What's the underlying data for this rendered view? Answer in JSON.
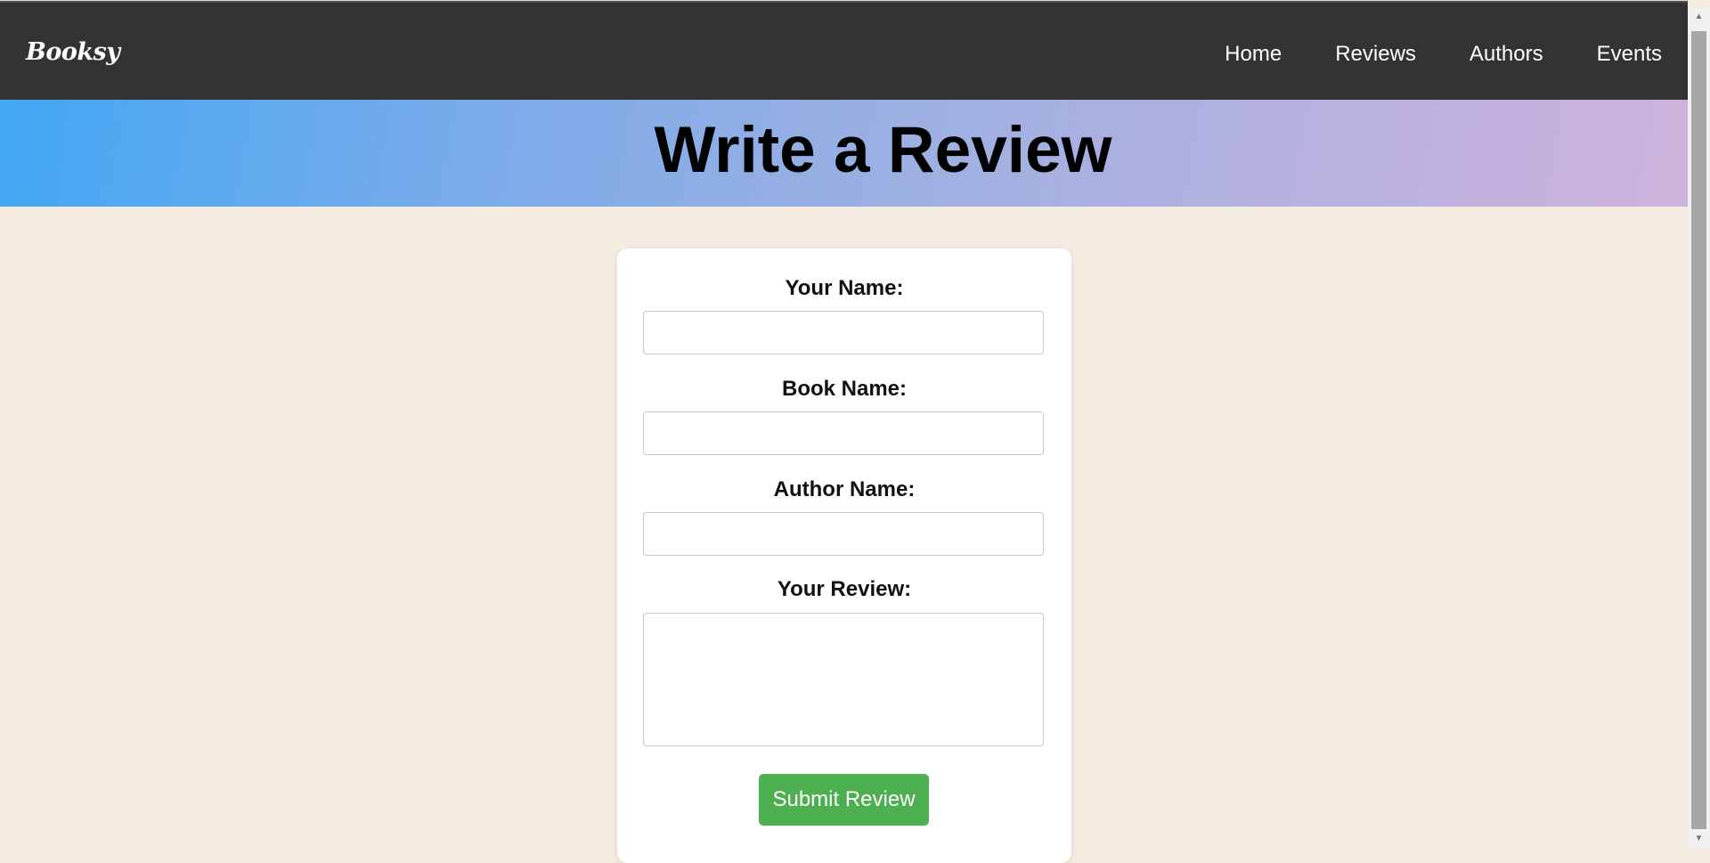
{
  "brand": {
    "logo_text": "Booksy"
  },
  "nav": {
    "items": [
      {
        "label": "Home"
      },
      {
        "label": "Reviews"
      },
      {
        "label": "Authors"
      },
      {
        "label": "Events"
      }
    ]
  },
  "banner": {
    "title": "Write a Review"
  },
  "form": {
    "your_name": {
      "label": "Your Name:",
      "value": ""
    },
    "book_name": {
      "label": "Book Name:",
      "value": ""
    },
    "author_name": {
      "label": "Author Name:",
      "value": ""
    },
    "your_review": {
      "label": "Your Review:",
      "value": ""
    },
    "submit_label": "Submit Review"
  },
  "colors": {
    "navbar": "#333333",
    "page_background": "#f4ebe1",
    "banner_gradient_start": "#42a8f3",
    "banner_gradient_end": "#cdb3dc",
    "submit_button": "#4caf50"
  },
  "icons": {
    "scroll_up": "scroll-up-arrow-icon",
    "scroll_down": "scroll-down-arrow-icon"
  }
}
